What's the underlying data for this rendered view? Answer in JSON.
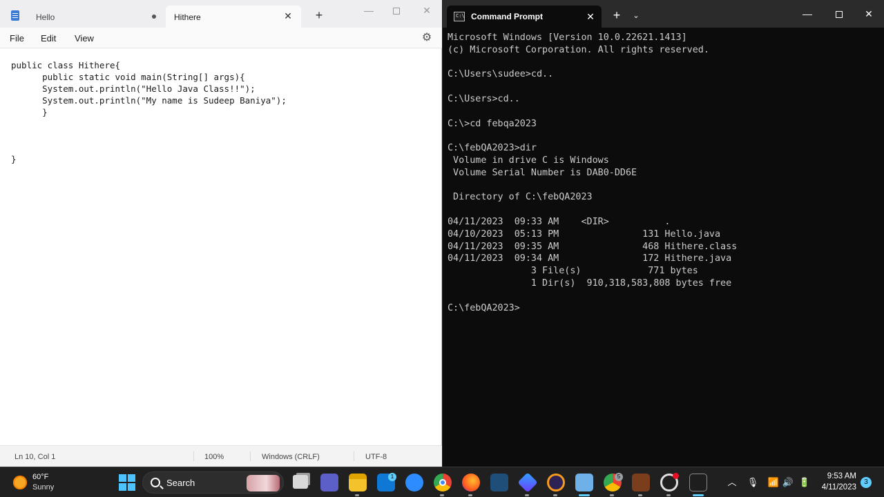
{
  "notepad": {
    "tabs": [
      {
        "label": "Hello"
      },
      {
        "label": "Hithere"
      }
    ],
    "menu": [
      "File",
      "Edit",
      "View"
    ],
    "code": "public class Hithere{\n      public static void main(String[] args){\n      System.out.println(\"Hello Java Class!!\");\n      System.out.println(\"My name is Sudeep Baniya\");\n      }\n\n\n\n}",
    "status": {
      "position": "Ln 10, Col 1",
      "zoom": "100%",
      "line_ending": "Windows (CRLF)",
      "encoding": "UTF-8"
    }
  },
  "terminal": {
    "tab_label": "Command Prompt",
    "tab_icon": "C:\\",
    "output": "Microsoft Windows [Version 10.0.22621.1413]\n(c) Microsoft Corporation. All rights reserved.\n\nC:\\Users\\sudee>cd..\n\nC:\\Users>cd..\n\nC:\\>cd febqa2023\n\nC:\\febQA2023>dir\n Volume in drive C is Windows\n Volume Serial Number is DAB0-DD6E\n\n Directory of C:\\febQA2023\n\n04/11/2023  09:33 AM    <DIR>          .\n04/10/2023  05:13 PM               131 Hello.java\n04/11/2023  09:35 AM               468 Hithere.class\n04/11/2023  09:34 AM               172 Hithere.java\n               3 File(s)            771 bytes\n               1 Dir(s)  910,318,583,808 bytes free\n\nC:\\febQA2023>"
  },
  "taskbar": {
    "weather": {
      "temp": "60°F",
      "desc": "Sunny"
    },
    "search_label": "Search",
    "clock": {
      "time": "9:53 AM",
      "date": "4/11/2023"
    },
    "notification_count": "3",
    "badges": {
      "mail": "1",
      "chrome_profile": "5"
    }
  },
  "colors": {
    "accent": "#60cdff",
    "terminal_bg": "#0c0c0c",
    "terminal_text": "#cccccc",
    "taskbar_bg": "#202020"
  },
  "icons": {
    "start": "windows-start-icon",
    "search": "search-icon",
    "gear": "gear-icon",
    "close": "close-icon",
    "add": "plus-icon",
    "dropdown": "chevron-down-icon"
  },
  "glyphs": {
    "close": "✕",
    "plus": "+",
    "minimize": "—",
    "chevron": "⌄",
    "gear": "⚙",
    "caret_up": "︿",
    "mic": "🎙",
    "wifi": "📶",
    "speaker": "🔊",
    "battery": "🔋"
  }
}
